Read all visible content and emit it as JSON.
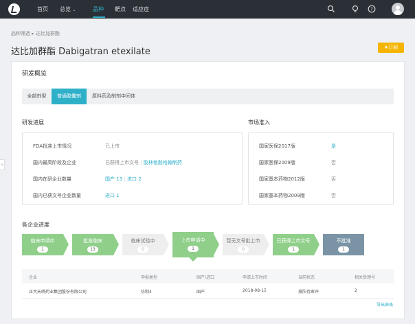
{
  "nav": {
    "items": [
      {
        "label": "首页"
      },
      {
        "label": "总览"
      },
      {
        "label": "品种"
      },
      {
        "label": "靶点"
      },
      {
        "label": "适应症"
      }
    ]
  },
  "breadcrumb": {
    "parent": "品种筛选",
    "current": "达比加群酯"
  },
  "title": "达比加群酯 Dabigatran etexilate",
  "subscribe_label": "订阅",
  "overview": {
    "title": "研发概览",
    "tabs": [
      "全部剂型",
      "普通胶囊剂",
      "原料药及制剂中间体"
    ]
  },
  "progress": {
    "title": "研发进展",
    "rows": [
      {
        "label": "FDA批准上市情况",
        "value": "已上市"
      },
      {
        "label": "国内最高阶段及企业",
        "value": "已获得上市文号",
        "link": "胶林格殷格翰制药"
      },
      {
        "label": "国内在研企业数量",
        "link": "国产 13",
        "link2": "进口 2"
      },
      {
        "label": "国内已获文号企业数量",
        "link": "进口 1"
      }
    ]
  },
  "market": {
    "title": "市场准入",
    "rows": [
      {
        "label": "国家医保2017版",
        "value": "是"
      },
      {
        "label": "国家医保2009版",
        "value": "否"
      },
      {
        "label": "国家基本药物2012版",
        "value": "否"
      },
      {
        "label": "国家基本药物2009版",
        "value": "否"
      }
    ]
  },
  "pipeline": {
    "title": "各企业进度",
    "stages": [
      {
        "label": "临床申请中",
        "count": "1"
      },
      {
        "label": "批准临床",
        "count": "13"
      },
      {
        "label": "临床试验中",
        "count": "0"
      },
      {
        "label": "上市申请中",
        "count": "1"
      },
      {
        "label": "暂无文号批上市",
        "count": "0"
      },
      {
        "label": "已获得上市文号",
        "count": "1"
      },
      {
        "label": "不批准",
        "count": "1"
      }
    ]
  },
  "table": {
    "headers": [
      "企业",
      "申报类型",
      "国产/进口",
      "申请上市时间",
      "当前状态",
      "相关受理号"
    ],
    "rows": [
      [
        "正大天晴药业集团股份有限公司",
        "仿制4",
        "国产",
        "2018-08-15",
        "排队待审评",
        "2"
      ]
    ],
    "export_label": "导出表格"
  },
  "colors": {
    "accent": "#2fb0c9",
    "stage_active": "#8fcf8a",
    "stage_rejected": "#7a94a6",
    "subscribe": "#f5b400"
  }
}
